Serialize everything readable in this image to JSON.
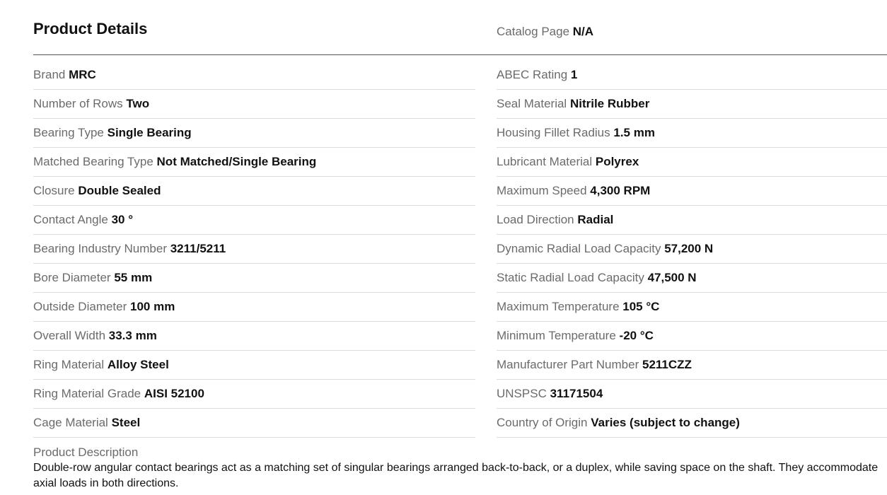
{
  "header": {
    "title": "Product Details",
    "catalog_label": "Catalog Page",
    "catalog_value": "N/A"
  },
  "left_rows": [
    {
      "label": "Brand",
      "value": "MRC"
    },
    {
      "label": "Number of Rows",
      "value": "Two"
    },
    {
      "label": "Bearing Type",
      "value": "Single Bearing"
    },
    {
      "label": "Matched Bearing Type",
      "value": "Not Matched/Single Bearing"
    },
    {
      "label": "Closure",
      "value": "Double Sealed"
    },
    {
      "label": "Contact Angle",
      "value": "30 °"
    },
    {
      "label": "Bearing Industry Number",
      "value": "3211/5211"
    },
    {
      "label": "Bore Diameter",
      "value": "55 mm"
    },
    {
      "label": "Outside Diameter",
      "value": "100 mm"
    },
    {
      "label": "Overall Width",
      "value": "33.3 mm"
    },
    {
      "label": "Ring Material",
      "value": "Alloy Steel"
    },
    {
      "label": "Ring Material Grade",
      "value": "AISI 52100"
    },
    {
      "label": "Cage Material",
      "value": "Steel"
    }
  ],
  "right_rows": [
    {
      "label": "ABEC Rating",
      "value": "1"
    },
    {
      "label": "Seal Material",
      "value": "Nitrile Rubber"
    },
    {
      "label": "Housing Fillet Radius",
      "value": "1.5 mm"
    },
    {
      "label": "Lubricant Material",
      "value": "Polyrex"
    },
    {
      "label": "Maximum Speed",
      "value": "4,300 RPM"
    },
    {
      "label": "Load Direction",
      "value": "Radial"
    },
    {
      "label": "Dynamic Radial Load Capacity",
      "value": "57,200 N"
    },
    {
      "label": "Static Radial Load Capacity",
      "value": "47,500 N"
    },
    {
      "label": "Maximum Temperature",
      "value": "105 °C"
    },
    {
      "label": "Minimum Temperature",
      "value": "-20 °C"
    },
    {
      "label": "Manufacturer Part Number",
      "value": "5211CZZ"
    },
    {
      "label": "UNSPSC",
      "value": "31171504"
    },
    {
      "label": "Country of Origin",
      "value": "Varies (subject to change)"
    }
  ],
  "description": {
    "label": "Product Description",
    "text": "Double-row angular contact bearings act as a matching set of singular bearings arranged back-to-back, or a duplex, while saving space on the shaft. They accommodate axial loads in both directions."
  }
}
